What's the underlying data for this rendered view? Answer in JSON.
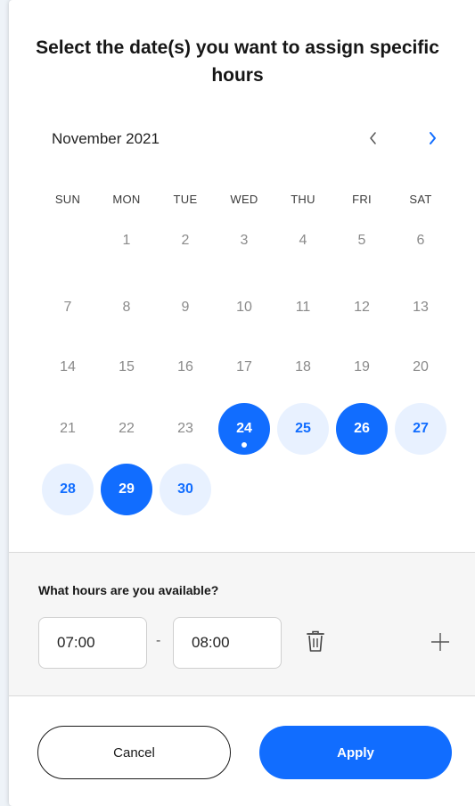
{
  "dialog": {
    "title": "Select the date(s) you want to assign specific hours"
  },
  "calendar": {
    "month_label": "November 2021",
    "prev_icon": "chevron-left-icon",
    "next_icon": "chevron-right-icon",
    "weekdays": [
      "SUN",
      "MON",
      "TUE",
      "WED",
      "THU",
      "FRI",
      "SAT"
    ],
    "weeks": [
      [
        null,
        "1",
        "2",
        "3",
        "4",
        "5",
        "6"
      ],
      [
        "7",
        "8",
        "9",
        "10",
        "11",
        "12",
        "13"
      ],
      [
        "14",
        "15",
        "16",
        "17",
        "18",
        "19",
        "20"
      ],
      [
        "21",
        "22",
        "23",
        "24",
        "25",
        "26",
        "27"
      ],
      [
        "28",
        "29",
        "30",
        null,
        null,
        null,
        null
      ]
    ],
    "selected_days": [
      "24",
      "26",
      "29"
    ],
    "available_days": [
      "25",
      "27",
      "28",
      "30"
    ],
    "today": "24"
  },
  "hours": {
    "question": "What hours are you available?",
    "start_time": "07:00",
    "separator": "-",
    "end_time": "08:00",
    "delete_icon": "trash-icon",
    "add_icon": "plus-icon"
  },
  "actions": {
    "cancel_label": "Cancel",
    "apply_label": "Apply"
  },
  "colors": {
    "accent": "#116dff",
    "available_bg": "#e8f1ff",
    "muted_text": "#8a8a8a"
  }
}
